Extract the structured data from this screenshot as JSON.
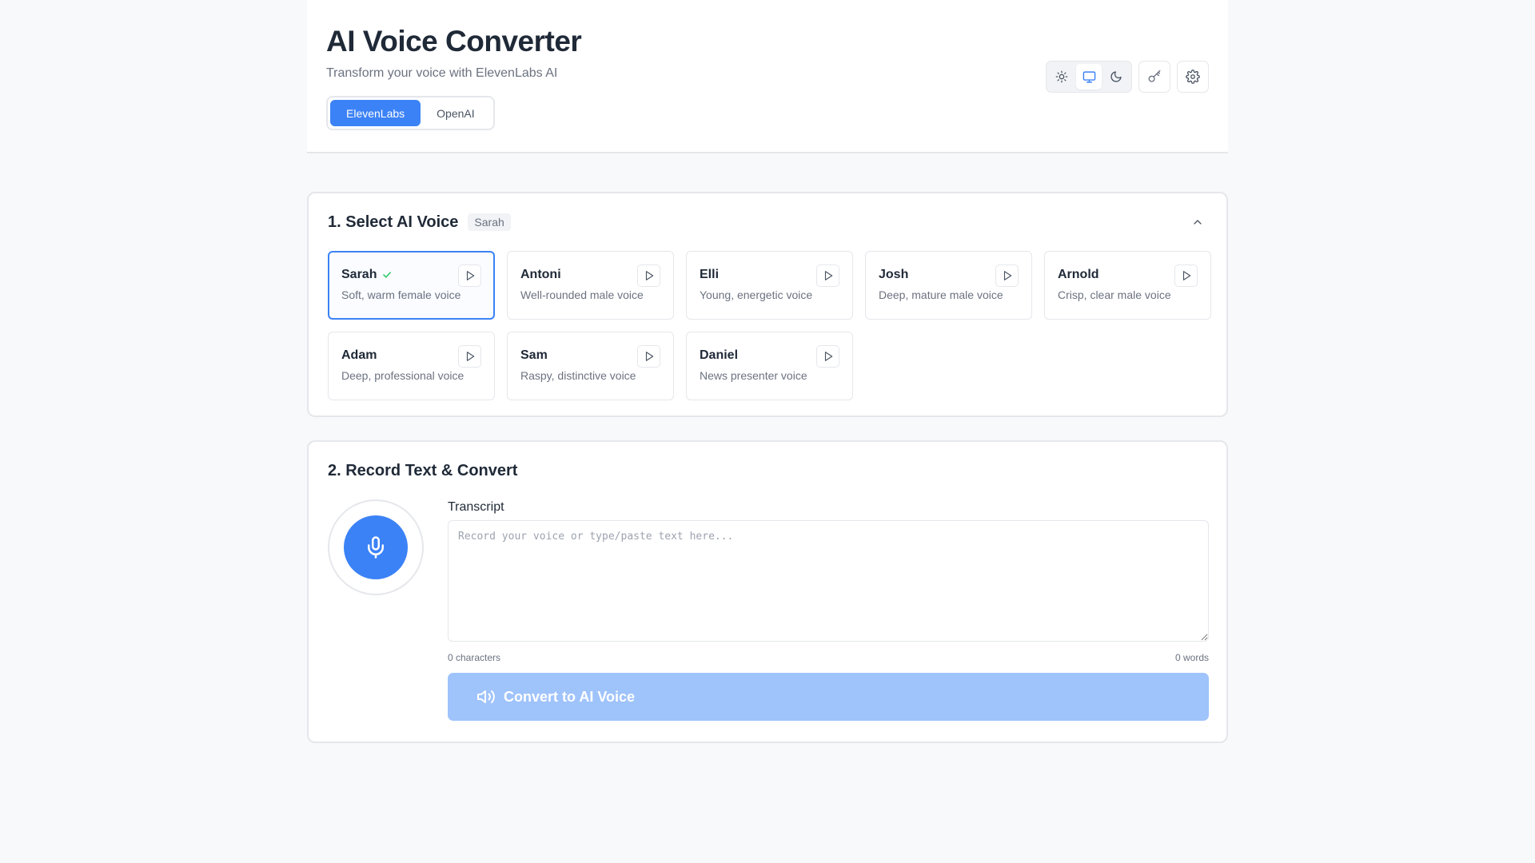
{
  "header": {
    "title": "AI Voice Converter",
    "subtitle": "Transform your voice with ElevenLabs AI",
    "providers": [
      {
        "label": "ElevenLabs",
        "active": true
      },
      {
        "label": "OpenAI",
        "active": false
      }
    ],
    "theme_options": [
      "sun-icon",
      "monitor-icon",
      "moon-icon"
    ],
    "active_theme": "monitor-icon",
    "tools": [
      "key-icon",
      "gear-icon"
    ]
  },
  "voice_section": {
    "title": "1. Select AI Voice",
    "selected_badge": "Sarah",
    "voices": [
      {
        "name": "Sarah",
        "desc": "Soft, warm female voice",
        "selected": true
      },
      {
        "name": "Antoni",
        "desc": "Well-rounded male voice",
        "selected": false
      },
      {
        "name": "Elli",
        "desc": "Young, energetic voice",
        "selected": false
      },
      {
        "name": "Josh",
        "desc": "Deep, mature male voice",
        "selected": false
      },
      {
        "name": "Arnold",
        "desc": "Crisp, clear male voice",
        "selected": false
      },
      {
        "name": "Adam",
        "desc": "Deep, professional voice",
        "selected": false
      },
      {
        "name": "Sam",
        "desc": "Raspy, distinctive voice",
        "selected": false
      },
      {
        "name": "Daniel",
        "desc": "News presenter voice",
        "selected": false
      }
    ]
  },
  "record_section": {
    "title": "2. Record Text & Convert",
    "transcript_label": "Transcript",
    "transcript_value": "",
    "transcript_placeholder": "Record your voice or type/paste text here...",
    "char_count": "0 characters",
    "word_count": "0 words",
    "convert_label": "Convert to AI Voice"
  },
  "colors": {
    "accent": "#3b82f6",
    "accent_disabled": "#9fc3fb",
    "check": "#22c55e"
  }
}
